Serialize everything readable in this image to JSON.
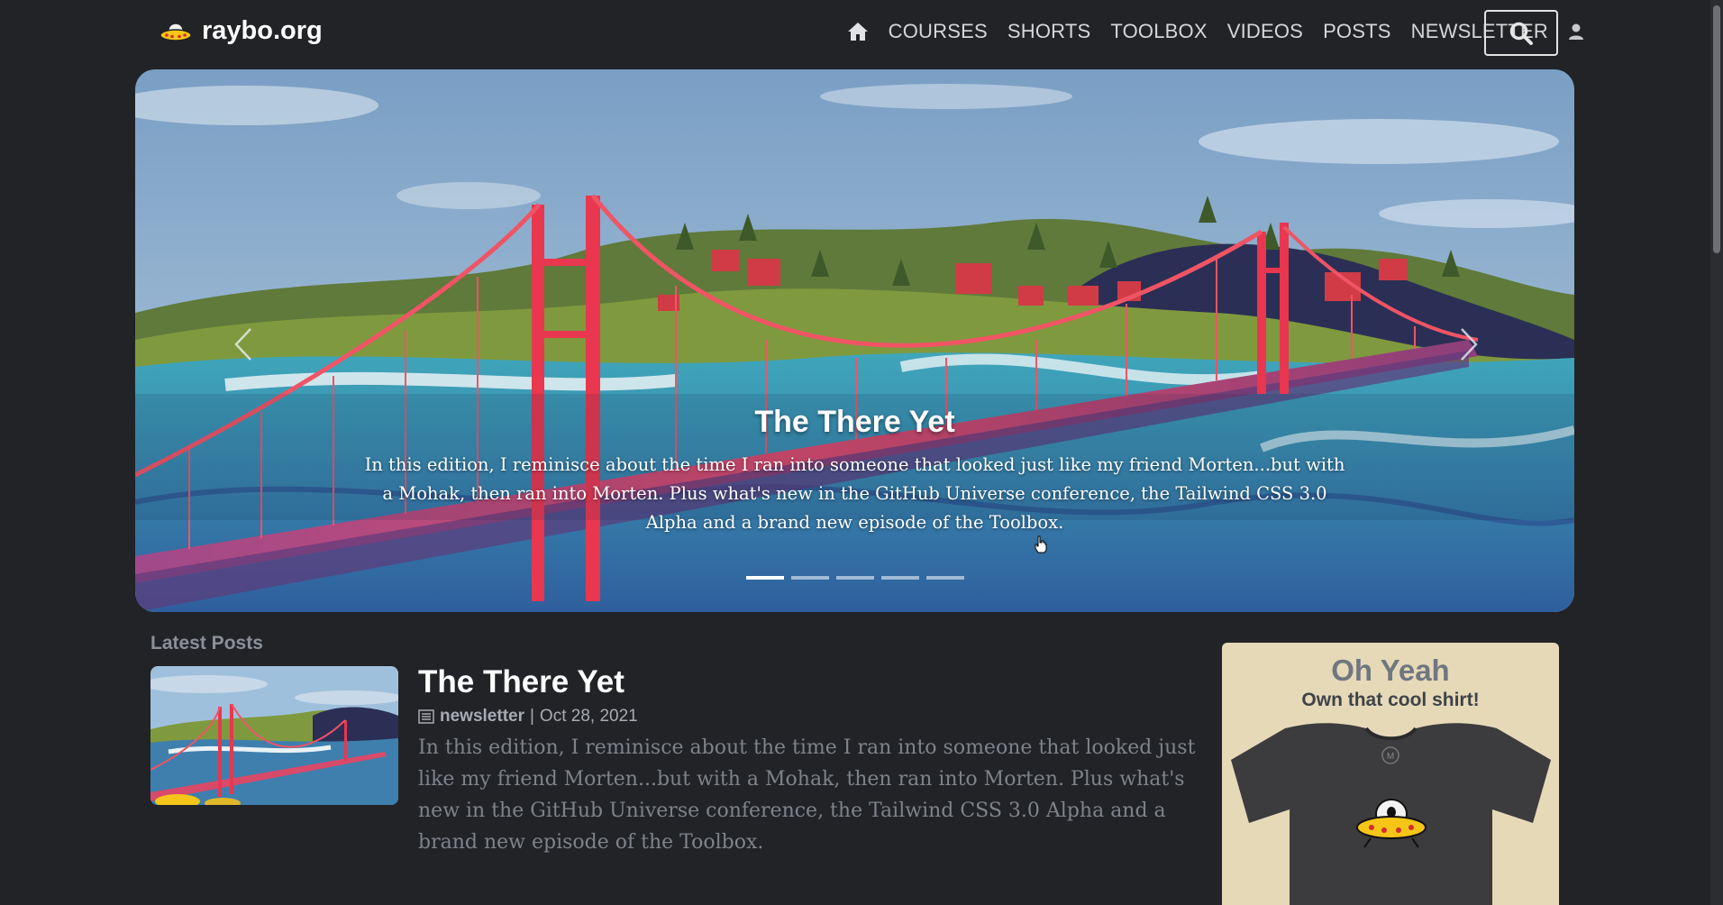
{
  "header": {
    "logo_text": "raybo.org",
    "nav": [
      "COURSES",
      "SHORTS",
      "TOOLBOX",
      "VIDEOS",
      "POSTS",
      "NEWSLETTER"
    ],
    "icons": [
      "home-icon",
      "user-icon",
      "search-icon"
    ]
  },
  "hero": {
    "title": "The There Yet",
    "text": "In this edition, I reminisce about the time I ran into someone that looked just like my friend Morten...but with a Mohak, then ran into Morten. Plus what's new in the GitHub Universe conference, the Tailwind CSS 3.0 Alpha and a brand new episode of the Toolbox.",
    "slide_count": 5,
    "active_slide": 1
  },
  "latest": {
    "label": "Latest Posts",
    "post": {
      "title": "The There Yet",
      "category": "newsletter",
      "separator": "|",
      "date": "Oct 28, 2021",
      "excerpt": "In this edition, I reminisce about the time I ran into someone that looked just like my friend Morten...but with a Mohak, then ran into Morten. Plus what's new in the GitHub Universe conference, the Tailwind CSS 3.0 Alpha and a brand new episode of the Toolbox."
    }
  },
  "promo": {
    "title": "Oh Yeah",
    "subtitle": "Own that cool shirt!"
  },
  "colors": {
    "background": "#212327",
    "nav_text": "#d6d6d8",
    "bridge": "#e8374f",
    "promo_bg": "#e6d9b8"
  }
}
